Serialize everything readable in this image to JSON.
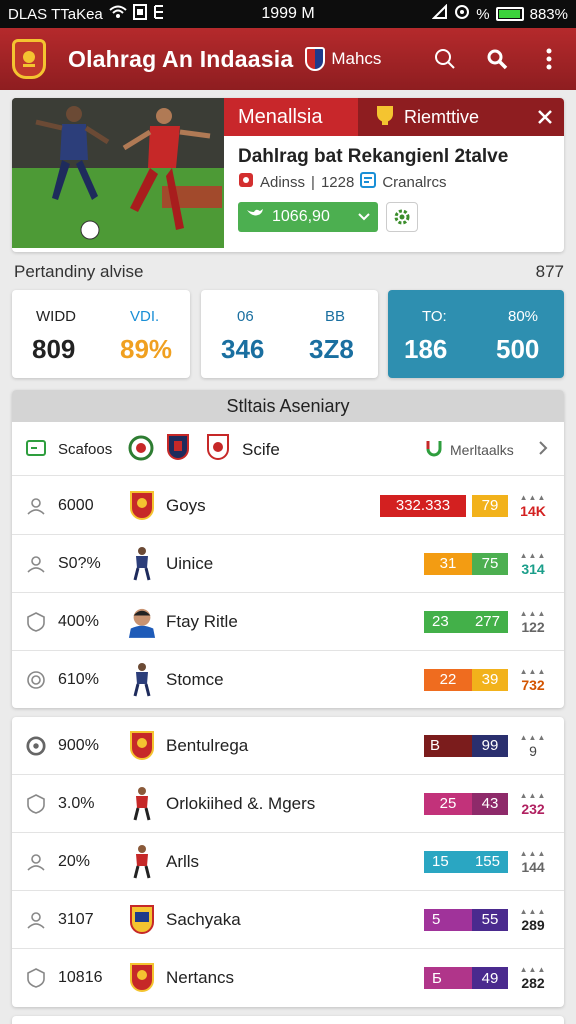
{
  "status_bar": {
    "carrier": "DLAS TTaKea",
    "time": "1999 M",
    "battery": "883%",
    "percent_sign": "%"
  },
  "app_bar": {
    "title": "Olahrag An Indaasia",
    "badge_label": "Mahcs"
  },
  "hero": {
    "tab_active": "Menallsia",
    "tab_secondary": "Riemttive",
    "headline": "Dahlrag bat Rekangienl 2talve",
    "meta_source": "Adinss",
    "meta_count": "1228",
    "meta_category": "Cranalrcs",
    "follow_value": "1066,90"
  },
  "section": {
    "label": "Pertandiny alvise",
    "count": "877"
  },
  "stats": [
    {
      "label_a": "WIDD",
      "value_a": "809",
      "label_b": "VDI.",
      "value_b": "89%"
    },
    {
      "label_a": "06",
      "value_a": "346",
      "label_b": "BB",
      "value_b": "3Z8"
    },
    {
      "label_a": "TO:",
      "value_a": "186",
      "label_b": "80%",
      "value_b": "500"
    }
  ],
  "table": {
    "title": "Stltais Aseniary",
    "header": {
      "left_label": "Scafoos",
      "mid_label": "Scife",
      "right_label": "Merltaalks"
    },
    "rows": [
      {
        "pct": "6000",
        "name": "Goys",
        "bar_a": "332.333",
        "bar_b": "79",
        "side": "14K"
      },
      {
        "pct": "S0?%",
        "name": "Uinice",
        "bar_a": "31",
        "bar_b": "75",
        "side": "314"
      },
      {
        "pct": "400%",
        "name": "Ftay Ritle",
        "bar_a": "23",
        "bar_b": "277",
        "side": "122"
      },
      {
        "pct": "610%",
        "name": "Stomce",
        "bar_a": "22",
        "bar_b": "39",
        "side": "732"
      }
    ]
  },
  "table2": {
    "rows": [
      {
        "pct": "900%",
        "name": "Bentulrega",
        "bar_a": "B",
        "bar_b": "99",
        "side": "9"
      },
      {
        "pct": "3.0%",
        "name": "Orlokiihed &. Mgers",
        "bar_a": "25",
        "bar_b": "43",
        "side": "232"
      },
      {
        "pct": "20%",
        "name": "Arlls",
        "bar_a": "15",
        "bar_b": "155",
        "side": "144"
      },
      {
        "pct": "3107",
        "name": "Sachyaka",
        "bar_a": "5",
        "bar_b": "55",
        "side": "289"
      },
      {
        "pct": "10816",
        "name": "Nertancs",
        "bar_a": "Б",
        "bar_b": "49",
        "side": "282"
      }
    ]
  }
}
